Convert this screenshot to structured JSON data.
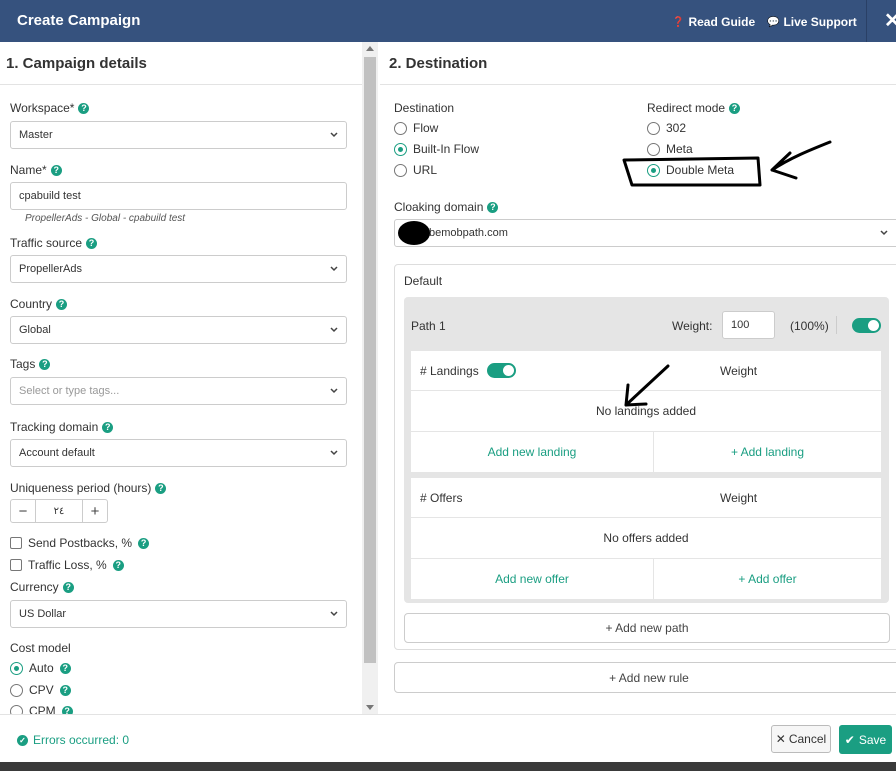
{
  "header": {
    "title": "Create Campaign",
    "read_guide": "Read Guide",
    "live_support": "Live Support",
    "close": "✕"
  },
  "left": {
    "title": "1. Campaign details",
    "workspace": {
      "label": "Workspace*",
      "value": "Master"
    },
    "name": {
      "label": "Name*",
      "value": "cpabuild test",
      "hint": "PropellerAds - Global - cpabuild test"
    },
    "traffic_source": {
      "label": "Traffic source",
      "value": "PropellerAds"
    },
    "country": {
      "label": "Country",
      "value": "Global"
    },
    "tags": {
      "label": "Tags",
      "placeholder": "Select or type tags..."
    },
    "tracking_domain": {
      "label": "Tracking domain",
      "value": "Account default"
    },
    "uniqueness": {
      "label": "Uniqueness period (hours)",
      "value": "٢٤",
      "minus": "−",
      "plus": "+"
    },
    "send_postbacks": "Send Postbacks, %",
    "traffic_loss": "Traffic Loss, %",
    "currency": {
      "label": "Currency",
      "value": "US Dollar"
    },
    "cost_model": {
      "label": "Cost model",
      "options": [
        "Auto",
        "CPV",
        "CPM"
      ],
      "selected": "Auto"
    }
  },
  "right": {
    "title": "2. Destination",
    "destination": {
      "label": "Destination",
      "options": [
        "Flow",
        "Built-In Flow",
        "URL"
      ],
      "selected": "Built-In Flow"
    },
    "redirect_mode": {
      "label": "Redirect mode",
      "options": [
        "302",
        "Meta",
        "Double Meta"
      ],
      "selected": "Double Meta"
    },
    "cloaking_domain": {
      "label": "Cloaking domain",
      "value": "bemobpath.com"
    },
    "default": {
      "label": "Default",
      "path": {
        "name": "Path 1",
        "weight_label": "Weight:",
        "weight_value": "100",
        "weight_percent": "(100%)",
        "enabled": true
      },
      "landings": {
        "header": "# Landings",
        "weight_header": "Weight",
        "enabled": true,
        "empty": "No landings added",
        "add_new": "Add new landing",
        "add": "+ Add landing"
      },
      "offers": {
        "header": "# Offers",
        "weight_header": "Weight",
        "empty": "No offers added",
        "add_new": "Add new offer",
        "add": "+ Add offer"
      },
      "add_path": "+ Add new path"
    },
    "add_rule": "+ Add new rule"
  },
  "footer": {
    "errors": "Errors occurred: 0",
    "cancel": "Cancel",
    "cancel_icon": "✕",
    "save": "Save",
    "save_icon": "✔"
  },
  "colors": {
    "header_bg": "#36527e",
    "accent": "#1a9e82"
  }
}
